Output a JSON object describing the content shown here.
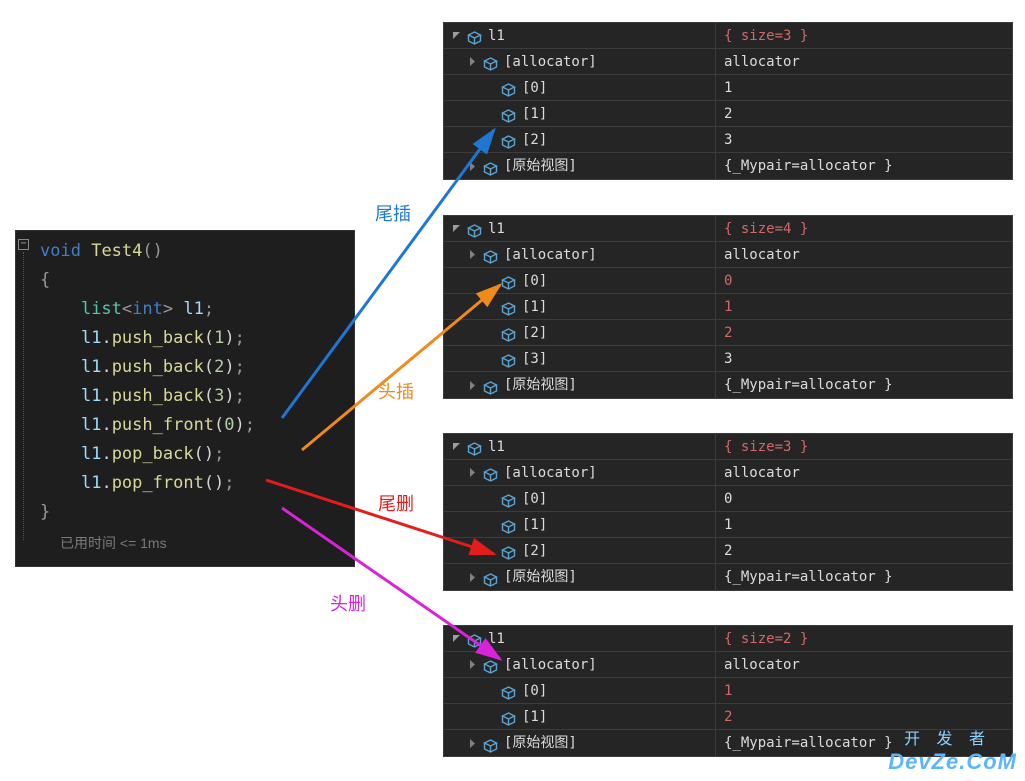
{
  "code": {
    "fn_kw": "void",
    "fn_name": "Test4",
    "parens": "()",
    "decl_type": "list",
    "decl_T": "int",
    "decl_var": "l1",
    "lines": {
      "pb1": "l1.push_back(1);",
      "pb2": "l1.push_back(2);",
      "pb3": "l1.push_back(3);",
      "pf0": "l1.push_front(0);",
      "popb": "l1.pop_back();",
      "popf": "l1.pop_front();"
    },
    "elapsed": "已用时间 <= 1ms"
  },
  "annotations": {
    "tail_insert": "尾插",
    "head_insert": "头插",
    "tail_del": "尾删",
    "head_del": "头删"
  },
  "watches": [
    {
      "id": "w1",
      "rows": [
        {
          "name": "l1",
          "value": "{ size=3 }",
          "depth": 0,
          "exp": "open",
          "val_class": "val-red"
        },
        {
          "name": "[allocator]",
          "value": "allocator",
          "depth": 1,
          "exp": "closed"
        },
        {
          "name": "[0]",
          "value": "1",
          "depth": 2,
          "exp": "none"
        },
        {
          "name": "[1]",
          "value": "2",
          "depth": 2,
          "exp": "none"
        },
        {
          "name": "[2]",
          "value": "3",
          "depth": 2,
          "exp": "none"
        },
        {
          "name": "[原始视图]",
          "value": "{_Mypair=allocator }",
          "depth": 1,
          "exp": "closed"
        }
      ]
    },
    {
      "id": "w2",
      "rows": [
        {
          "name": "l1",
          "value": "{ size=4 }",
          "depth": 0,
          "exp": "open",
          "val_class": "val-red"
        },
        {
          "name": "[allocator]",
          "value": "allocator",
          "depth": 1,
          "exp": "closed"
        },
        {
          "name": "[0]",
          "value": "0",
          "depth": 2,
          "exp": "none",
          "val_class": "val-red"
        },
        {
          "name": "[1]",
          "value": "1",
          "depth": 2,
          "exp": "none",
          "val_class": "val-red"
        },
        {
          "name": "[2]",
          "value": "2",
          "depth": 2,
          "exp": "none",
          "val_class": "val-red"
        },
        {
          "name": "[3]",
          "value": "3",
          "depth": 2,
          "exp": "none"
        },
        {
          "name": "[原始视图]",
          "value": "{_Mypair=allocator }",
          "depth": 1,
          "exp": "closed"
        }
      ]
    },
    {
      "id": "w3",
      "rows": [
        {
          "name": "l1",
          "value": "{ size=3 }",
          "depth": 0,
          "exp": "open",
          "val_class": "val-red"
        },
        {
          "name": "[allocator]",
          "value": "allocator",
          "depth": 1,
          "exp": "closed"
        },
        {
          "name": "[0]",
          "value": "0",
          "depth": 2,
          "exp": "none"
        },
        {
          "name": "[1]",
          "value": "1",
          "depth": 2,
          "exp": "none"
        },
        {
          "name": "[2]",
          "value": "2",
          "depth": 2,
          "exp": "none"
        },
        {
          "name": "[原始视图]",
          "value": "{_Mypair=allocator }",
          "depth": 1,
          "exp": "closed"
        }
      ]
    },
    {
      "id": "w4",
      "rows": [
        {
          "name": "l1",
          "value": "{ size=2 }",
          "depth": 0,
          "exp": "open",
          "val_class": "val-red"
        },
        {
          "name": "[allocator]",
          "value": "allocator",
          "depth": 1,
          "exp": "closed"
        },
        {
          "name": "[0]",
          "value": "1",
          "depth": 2,
          "exp": "none",
          "val_class": "val-red"
        },
        {
          "name": "[1]",
          "value": "2",
          "depth": 2,
          "exp": "none",
          "val_class": "val-red"
        },
        {
          "name": "[原始视图]",
          "value": "{_Mypair=allocator }",
          "depth": 1,
          "exp": "closed"
        }
      ]
    }
  ],
  "watermark": "DevZe.CoM",
  "watermark_cn": "开 发 者"
}
